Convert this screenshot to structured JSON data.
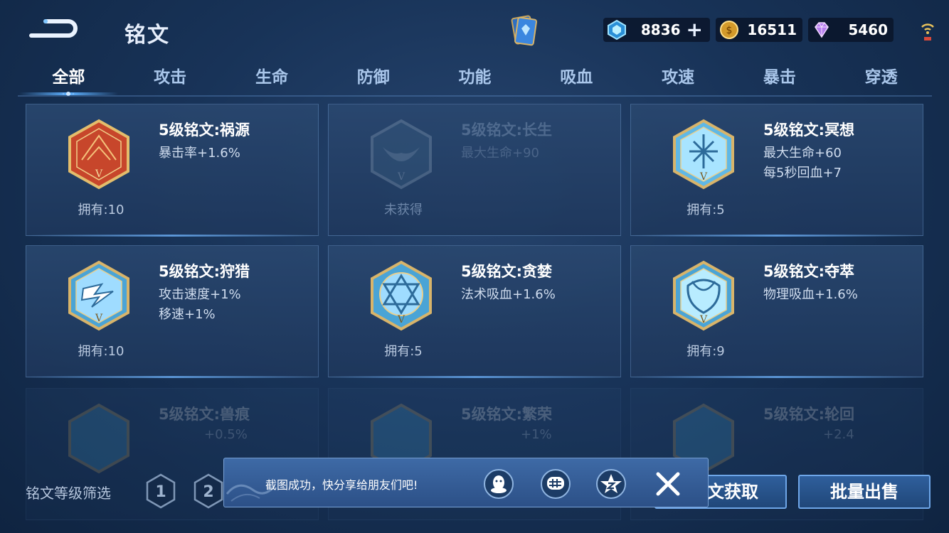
{
  "header": {
    "title": "铭文",
    "resources": [
      {
        "icon": "crystal-icon",
        "value": "8836"
      },
      {
        "icon": "gold-coin-icon",
        "value": "16511"
      },
      {
        "icon": "diamond-icon",
        "value": "5460"
      }
    ],
    "add_symbol": "+"
  },
  "tabs": [
    "全部",
    "攻击",
    "生命",
    "防御",
    "功能",
    "吸血",
    "攻速",
    "暴击",
    "穿透"
  ],
  "active_tab": "全部",
  "runes": [
    {
      "name": "5级铭文:祸源",
      "attrs": [
        "暴击率+1.6%"
      ],
      "own": "拥有:10",
      "owned": true
    },
    {
      "name": "5级铭文:长生",
      "attrs": [
        "最大生命+90"
      ],
      "own": "未获得",
      "owned": false
    },
    {
      "name": "5级铭文:冥想",
      "attrs": [
        "最大生命+60",
        "每5秒回血+7"
      ],
      "own": "拥有:5",
      "owned": true
    },
    {
      "name": "5级铭文:狩猎",
      "attrs": [
        "攻击速度+1%",
        "移速+1%"
      ],
      "own": "拥有:10",
      "owned": true
    },
    {
      "name": "5级铭文:贪婪",
      "attrs": [
        "法术吸血+1.6%"
      ],
      "own": "拥有:5",
      "owned": true
    },
    {
      "name": "5级铭文:夺萃",
      "attrs": [
        "物理吸血+1.6%"
      ],
      "own": "拥有:9",
      "owned": true
    },
    {
      "name": "5级铭文:兽痕",
      "attrs": [
        "+0.5%"
      ],
      "own": "",
      "owned": true
    },
    {
      "name": "5级铭文:繁荣",
      "attrs": [
        "+1%"
      ],
      "own": "",
      "owned": true
    },
    {
      "name": "5级铭文:轮回",
      "attrs": [
        "+2.4"
      ],
      "own": "",
      "owned": true
    }
  ],
  "bottom": {
    "filter_label": "铭文等级筛选",
    "levels": [
      "1",
      "2"
    ],
    "obtain_button": "文获取",
    "sell_button": "批量出售"
  },
  "toast": {
    "message": "截图成功，快分享给朋友们吧!",
    "share_icons": [
      "qq-icon",
      "wechat-moments-icon",
      "qzone-icon"
    ]
  },
  "colors": {
    "accent": "#5db0ff",
    "gold": "#d8b46a",
    "background": "#183358"
  }
}
